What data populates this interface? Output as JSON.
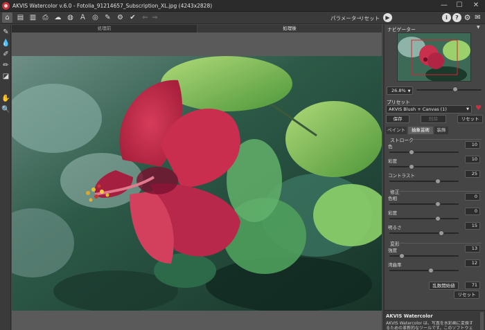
{
  "window": {
    "title": "AKVIS Watercolor v.6.0 - Fotolia_91214657_Subscription_XL.jpg (4243x2828)",
    "minimize": "—",
    "maximize": "☐",
    "close": "✕"
  },
  "toolbar": {
    "parameters": "パラメーター",
    "reset": "リセット"
  },
  "view_tabs": {
    "before": "処理前",
    "after": "処理後"
  },
  "navigator": {
    "title": "ナビゲーター",
    "zoom": "26.8%",
    "zoom_fraction": 0.6
  },
  "presets": {
    "title": "プリセット",
    "selected": "AKVIS Blush + Canvas (1)",
    "save": "保存",
    "delete": "削除",
    "reset": "リセット"
  },
  "tabs": [
    "ペイント",
    "抽象芸術",
    "装飾"
  ],
  "active_tab": 1,
  "sections": {
    "stroke": {
      "title": "ストローク",
      "params": [
        {
          "label": "色",
          "value": "10",
          "level": 0.32
        },
        {
          "label": "彩度",
          "value": "10",
          "level": 0.32
        },
        {
          "label": "コントラスト",
          "value": "25",
          "level": 0.7
        }
      ]
    },
    "correction": {
      "title": "修正",
      "params": [
        {
          "label": "色相",
          "value": "0",
          "level": 0.7
        },
        {
          "label": "彩度",
          "value": "0",
          "level": 0.7
        },
        {
          "label": "明るさ",
          "value": "15",
          "level": 0.75
        }
      ]
    },
    "distortion": {
      "title": "変形",
      "params": [
        {
          "label": "強度",
          "value": "13",
          "level": 0.18
        },
        {
          "label": "湾曲率",
          "value": "12",
          "level": 0.6
        }
      ]
    },
    "random_seed": {
      "label": "乱数開始値",
      "value": "71"
    },
    "reset": "リセット"
  },
  "help": {
    "title": "AKVIS Watercolor",
    "text": "AKVIS Watercolor は、写真を水彩画に変換するための革新的なツールです。このソフトウェアがあれば、簡単に美しい水彩画を作り出すことができます。"
  }
}
